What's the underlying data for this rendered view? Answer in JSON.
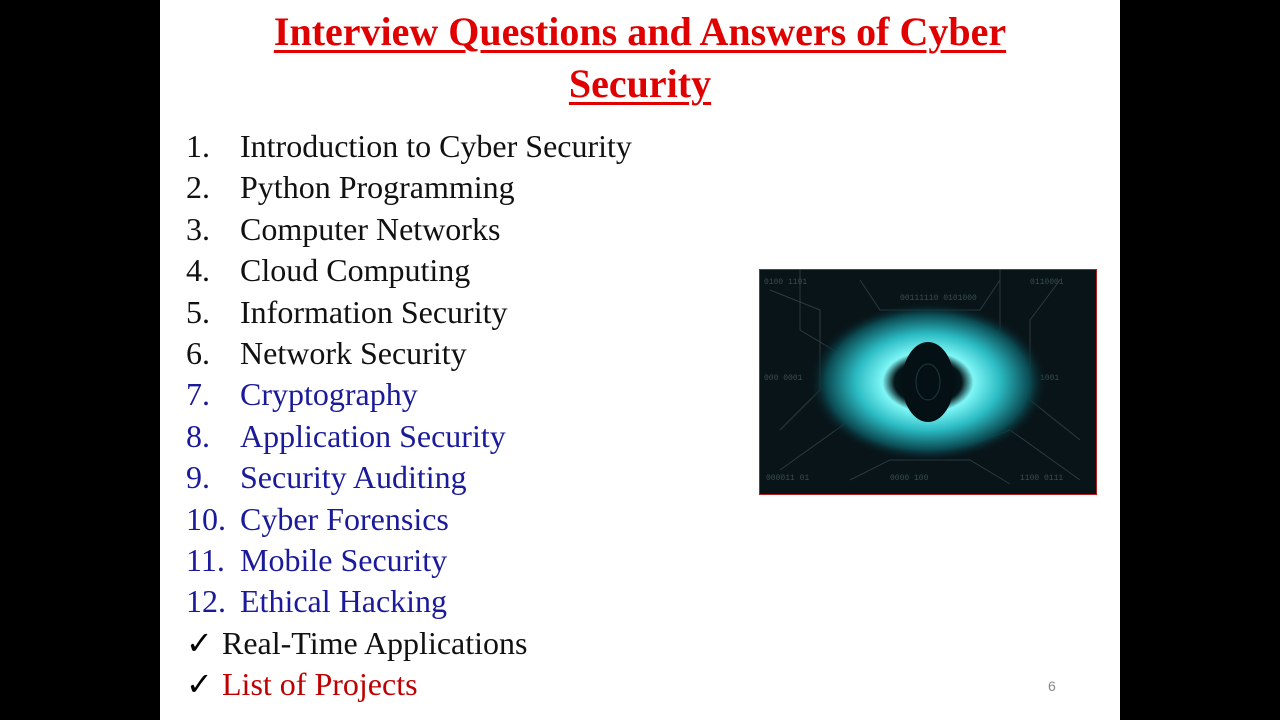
{
  "slide": {
    "title_line1": "Interview Questions and Answers of Cyber",
    "title_line2": "Security",
    "items": [
      {
        "num": "1.",
        "label": "Introduction to Cyber Security",
        "color": "#111111"
      },
      {
        "num": "2.",
        "label": "Python Programming",
        "color": "#111111"
      },
      {
        "num": "3.",
        "label": "Computer Networks",
        "color": "#111111"
      },
      {
        "num": "4.",
        "label": "Cloud Computing",
        "color": "#111111"
      },
      {
        "num": "5.",
        "label": "Information Security",
        "color": "#111111"
      },
      {
        "num": "6.",
        "label": "Network Security",
        "color": "#111111"
      },
      {
        "num": "7.",
        "label": "Cryptography",
        "color": "#1a1a9a"
      },
      {
        "num": "8.",
        "label": "Application Security",
        "color": "#1a1a9a"
      },
      {
        "num": "9.",
        "label": "Security Auditing",
        "color": "#1a1a9a"
      },
      {
        "num": "10.",
        "label": "Cyber Forensics",
        "color": "#1a1a9a"
      },
      {
        "num": "11.",
        "label": "Mobile Security",
        "color": "#1a1a9a"
      },
      {
        "num": "12.",
        "label": "Ethical Hacking",
        "color": "#1a1a9a"
      }
    ],
    "checks": [
      {
        "icon": "checkmark-icon",
        "glyph": "✓",
        "label": "Real-Time Applications",
        "color": "#111111"
      },
      {
        "icon": "checkmark-icon",
        "glyph": "✓",
        "label": "List of Projects",
        "color": "#c00000"
      }
    ],
    "image_alt": "cyber eye illustration",
    "page_number": "6"
  },
  "colors": {
    "title": "#e00000",
    "topics_basic": "#111111",
    "topics_advanced": "#1a1a9a",
    "highlight": "#c00000",
    "image_glow": "#3fe0e6"
  }
}
